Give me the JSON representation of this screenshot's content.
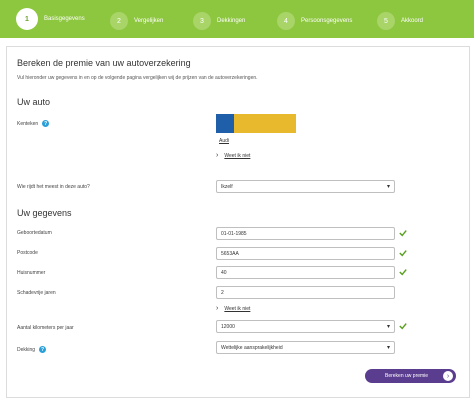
{
  "steps": [
    {
      "num": "1",
      "label": "Basisgegevens"
    },
    {
      "num": "2",
      "label": "Vergelijken"
    },
    {
      "num": "3",
      "label": "Dekkingen"
    },
    {
      "num": "4",
      "label": "Persoonsgegevens"
    },
    {
      "num": "5",
      "label": "Akkoord"
    }
  ],
  "page": {
    "title": "Bereken de premie van uw autoverzekering",
    "intro": "Vul hieronder uw gegevens in en op de volgende pagina vergelijken wij de prijzen van de autoverzekeringen."
  },
  "car": {
    "section_title": "Uw auto",
    "kenteken_label": "Kenteken",
    "help_glyph": "?",
    "car_name": "Audi",
    "weet_niet_link": "Weet ik niet",
    "driver_label": "Wie rijdt het meest in deze auto?",
    "driver_value": "Ikzelf"
  },
  "personal": {
    "section_title": "Uw gegevens",
    "birthdate_label": "Geboortedatum",
    "birthdate_value": "01-01-1985",
    "postcode_label": "Postcode",
    "postcode_value": "5653AA",
    "huisnummer_label": "Huisnummer",
    "huisnummer_value": "40",
    "schadevrije_label": "Schadevrije jaren",
    "schadevrije_value": "2",
    "weet_niet_link": "Weet ik niet",
    "km_label": "Aantal kilometers per jaar",
    "km_value": "12000",
    "dekking_label": "Dekking",
    "dekking_value": "Wettelijke aansprakelijkheid"
  },
  "cta": {
    "label": "Bereken uw premie",
    "arrow": "›"
  },
  "colors": {
    "green": "#8dc63f",
    "purple": "#5b3d8f",
    "check": "#5aa020",
    "help": "#2a9fd8"
  }
}
